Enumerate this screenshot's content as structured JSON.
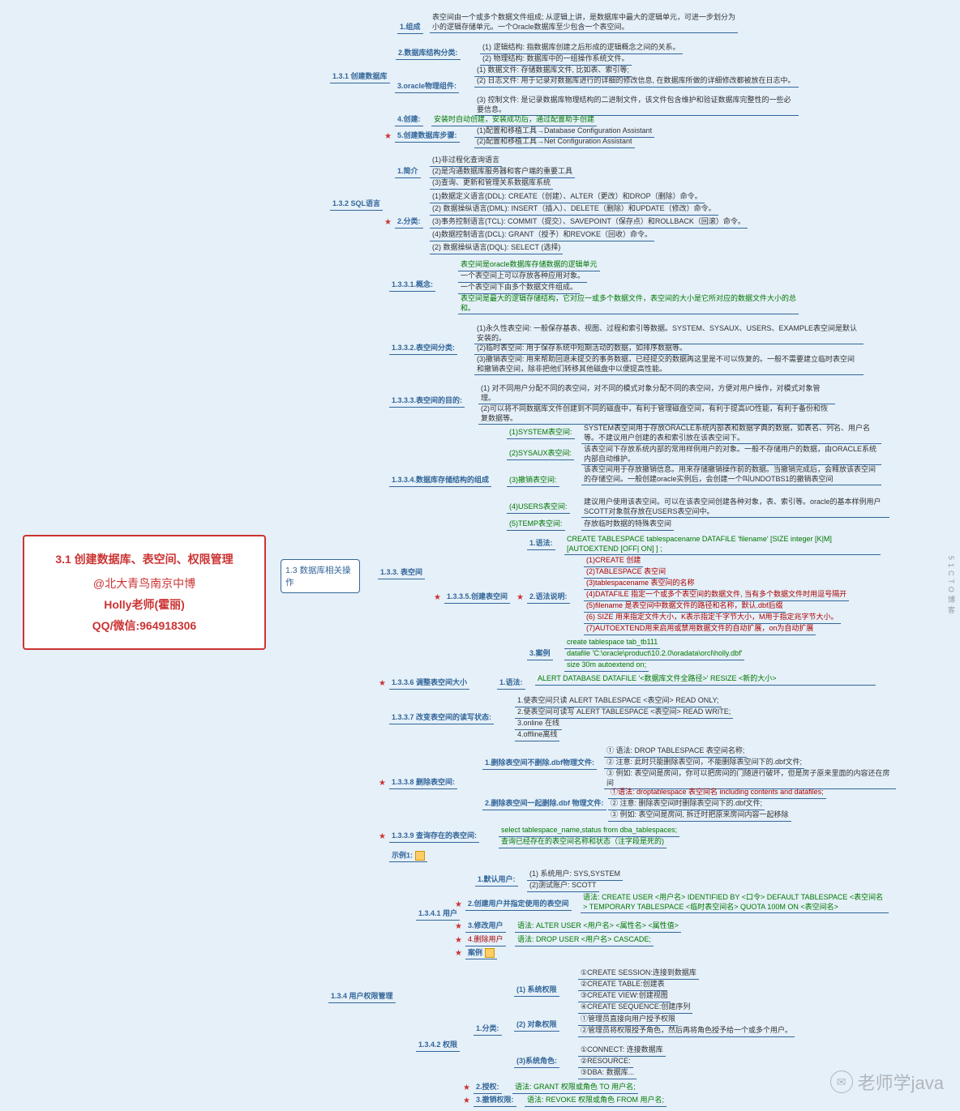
{
  "root": {
    "title": "3.1 创建数据库、表空间、权限管理",
    "author_line": "@北大青鸟南京中博",
    "teacher": "Holly老师(霍丽)",
    "contact": "QQ/微信:964918306"
  },
  "main": {
    "label": "1.3 数据库相关操作"
  },
  "s131": {
    "label": "1.3.1 创建数据库",
    "n1": {
      "l": "1.组成",
      "t": "表空间由一个或多个数据文件组成; 从逻辑上讲，是数据库中最大的逻辑单元，可进一步划分为小的逻辑存储单元。一个Oracle数据库至少包含一个表空间。"
    },
    "n2": {
      "l": "2.数据库结构分类:",
      "a": "(1) 逻辑结构: 指数据库创建之后形成的逻辑概念之间的关系。",
      "b": "(2) 物理结构: 数据库中的一组操作系统文件。"
    },
    "n3": {
      "l": "3.oracle物理组件:",
      "a": "(1) 数据文件: 存储数据库文件, 比如表、索引等;",
      "b": "(2) 日志文件: 用于记录对数据库进行的详细的修改信息, 在数据库所做的详细修改都被放在日志中。",
      "c": "(3) 控制文件: 是记录数据库物理结构的二进制文件，该文件包含维护和验证数据库完整性的一些必要信息。"
    },
    "n4": {
      "l": "4.创建:",
      "t": "安装时自动创建，安装成功后，通过配置助手创建"
    },
    "n5": {
      "l": "5.创建数据库步骤:",
      "a": "(1)配置和移植工具→Database Configuration Assistant",
      "b": "(2)配置和移植工具→Net Configuration Assistant"
    }
  },
  "s132": {
    "label": "1.3.2 SQL语言",
    "n1": {
      "l": "1.简介",
      "a": "(1)非过程化查询语言",
      "b": "(2)是沟通数据库服务器和客户端的重要工具",
      "c": "(3)查询、更新和管理关系数据库系统"
    },
    "n2": {
      "l": "2.分类:",
      "a": "(1)数据定义语言(DDL):   CREATE（创建）、ALTER（更改）和DROP（删除）命令。",
      "b": "(2) 数据操纵语言(DML):   INSERT（插入）、DELETE（删除）和UPDATE（修改）命令。",
      "c": "(3)事务控制语言(TCL):   COMMIT（提交）、SAVEPOINT（保存点）和ROLLBACK（回滚）命令。",
      "d": "(4)数据控制语言(DCL):   GRANT（授予）和REVOKE（回收）命令。",
      "e": "(2) 数据操纵语言(DQL):   SELECT (选择)"
    }
  },
  "s133": {
    "label": "1.3.3. 表空间"
  },
  "s1331": {
    "l": "1.3.3.1.概念:",
    "a": "表空间是oracle数据库存储数据的逻辑单元",
    "b": "一个表空间上可以存放各种应用对象。",
    "c": "一个表空间下由多个数据文件组成。",
    "d": "表空间是最大的逻辑存储结构，它对应一或多个数据文件，表空间的大小是它所对应的数据文件大小的总和。"
  },
  "s1332": {
    "l": "1.3.3.2.表空间分类:",
    "a": "(1)永久性表空间:   一般保存基表、视图、过程和索引等数据。SYSTEM、SYSAUX、USERS、EXAMPLE表空间是默认安装的。",
    "b": "(2)临时表空间:   用于保存系统中短期活动的数据，如排序数据等。",
    "c": "(3)撤销表空间:   用来帮助回退未提交的事务数据，已经提交的数据再这里是不可以恢复的。一般不需要建立临时表空间和撤销表空间，除非把他们转移其他磁盘中以便提高性能。"
  },
  "s1333": {
    "l": "1.3.3.3.表空间的目的:",
    "a": "(1) 对不同用户分配不同的表空间，对不同的模式对象分配不同的表空间，方便对用户操作，对模式对象管理。",
    "b": "(2)可以将不同数据库文件创建到不同的磁盘中，有利于管理磁盘空间，有利于提高I/O性能，有利于备份和恢复数据等。"
  },
  "s1334": {
    "l": "1.3.3.4.数据库存储结构的组成",
    "a1l": "(1)SYSTEM表空间:",
    "a1t": "SYSTEM表空间用于存放ORACLE系统内部表和数据字典的数据，如表名、列名、用户名等。不建议用户创建的表和索引放在该表空间下。",
    "a2l": "(2)SYSAUX表空间:",
    "a2t": "该表空间下存放系统内部的常用样例用户的对象。一般不存储用户的数据，由ORACLE系统内部自动维护。",
    "a3l": "(3)撤销表空间:",
    "a3t": "该表空间用于存放撤销信息。用来存储撤销操作前的数据。当撤销完成后，会释放该表空间的存储空间。一般创建oracle实例后，会创建一个叫UNDOTBS1的撤销表空间",
    "a4l": "(4)USERS表空间:",
    "a4t": "建议用户使用该表空间。可以在该表空间创建各种对象，表、索引等。oracle的基本样例用户SCOTT对象就存放在USERS表空间中。",
    "a5l": "(5)TEMP表空间:",
    "a5t": "存放临时数据的特殊表空间"
  },
  "s1335": {
    "l": "1.3.3.5.创建表空间",
    "n1": {
      "l": "1.语法:",
      "t": "CREATE TABLESPACE tablespacename DATAFILE 'filename' [SIZE integer [K|M] [AUTOEXTEND [OFF| ON] ] ;"
    },
    "n2": {
      "l": "2.语法说明:",
      "a": "(1)CREATE 创建",
      "b": "(2)TABLESPACE 表空间",
      "c": "(3)tablespacename 表空间的名称",
      "d": "(4)DATAFILE 指定一个或多个表空间的数据文件, 当有多个数据文件时用逗号隔开",
      "e": "(5)filename 是表空间中数据文件的路径和名称，默认.dbf后缀",
      "f": "(6) SIZE 用来指定文件大小，K表示指定千字节大小，M用于指定兆字节大小。",
      "g": "(7)AUTOEXTEND用来启用或禁用数据文件的自动扩展，on为自动扩展"
    },
    "n3": {
      "l": "3.案例",
      "a": "create tablespace tab_tb111",
      "b": "datafile 'C:\\oracle\\product\\10.2.0\\oradata\\orcl\\holly.dbf'",
      "c": "size 30m autoextend on;"
    }
  },
  "s1336": {
    "l": "1.3.3.6 调整表空间大小",
    "n1": "1.语法:",
    "t": "ALERT DATABASE  DATAFILE '<数据库文件全路径>' RESIZE <新的大小>"
  },
  "s1337": {
    "l": "1.3.3.7 改变表空间的读写状态:",
    "a": "1.使表空间只读   ALERT TABLESPACE <表空间> READ ONLY;",
    "b": "2.使表空间可读写   ALERT TABLESPACE <表空间> READ WRITE;",
    "c": "3.online 在线",
    "d": "4.offline离线"
  },
  "s1338": {
    "l": "1.3.3.8  删除表空间:",
    "n1": {
      "l": "1.删除表空间不删除.dbf物理文件:",
      "a": "① 语法:  DROP TABLESPACE  表空间名称;",
      "b": "② 注意: 此时只能删除表空间，不能删除表空间下的.dbf文件;",
      "c": "③ 例如: 表空间是房间，你可以把房间的门随进行破坏，但是房子原来里面的内容还在房间"
    },
    "n2": {
      "l": "2.删除表空间一起删除.dbf 物理文件:",
      "a": "①语法:  droptablespace 表空间名 including contents  and datafiles;",
      "b": "② 注意: 删除表空间时删除表空间下的.dbf文件;",
      "c": "③ 例如: 表空间是房间, 拆迁时把原来房间内容一起移除"
    }
  },
  "s1339": {
    "l": "1.3.3.9 查询存在的表空间:",
    "a": "select tablespace_name,status from dba_tablespaces;",
    "b": "查询已经存在的表空间名称和状态（注字段是死的)"
  },
  "s133x": {
    "l": "示例1:"
  },
  "s134": {
    "label": "1.3.4 用户权限管理"
  },
  "s1341": {
    "l": "1.3.4.1 用户",
    "n1": {
      "l": "1.默认用户:",
      "a": "(1) 系统用户: SYS,SYSTEM",
      "b": "(2)测试账户:  SCOTT"
    },
    "n2": {
      "l": "2.创建用户并指定使用的表空间",
      "t": "语法: CREATE USER <用户名> IDENTIFIED BY <口令>  DEFAULT TABLESPACE <表空间名> TEMPORARY TABLESPACE <临时表空间名> QUOTA 100M ON <表空间名>"
    },
    "n3": {
      "l": "3.修改用户",
      "t": "语法:  ALTER USER <用户名> <属性名>  <属性值>"
    },
    "n4": {
      "l": "4.删除用户",
      "t": "语法:  DROP USER <用户名> CASCADE;"
    },
    "n5": {
      "l": "案例"
    }
  },
  "s1342": {
    "l": "1.3.4.2 权限",
    "n1": {
      "l": "1.分类:",
      "a": {
        "l": "(1) 系统权限",
        "a": "①CREATE  SESSION:连接到数据库",
        "b": "②CREATE TABLE:创建表",
        "c": "③CREATE  VIEW:创建视图",
        "d": "④CREATE  SEQUENCE:创建序列"
      },
      "b": {
        "l": "(2) 对象权限",
        "a": "①管理员直接向用户授予权限",
        "b": "②管理员将权限授予角色，然后再将角色授予给一个或多个用户。"
      },
      "c": {
        "l": "(3)系统角色:",
        "a": "①CONNECT: 连接数据库",
        "b": "②RESOURCE:",
        "c": "③DBA: 数据库..."
      }
    },
    "n2": {
      "l": "2.授权:",
      "t": "语法: GRANT 权限或角色 TO 用户名;"
    },
    "n3": {
      "l": "3.撤销权限:",
      "t": "语法: REVOKE 权限或角色  FROM  用户名;"
    }
  },
  "watermark": "老师学java",
  "sidebar": "51CTO博客"
}
